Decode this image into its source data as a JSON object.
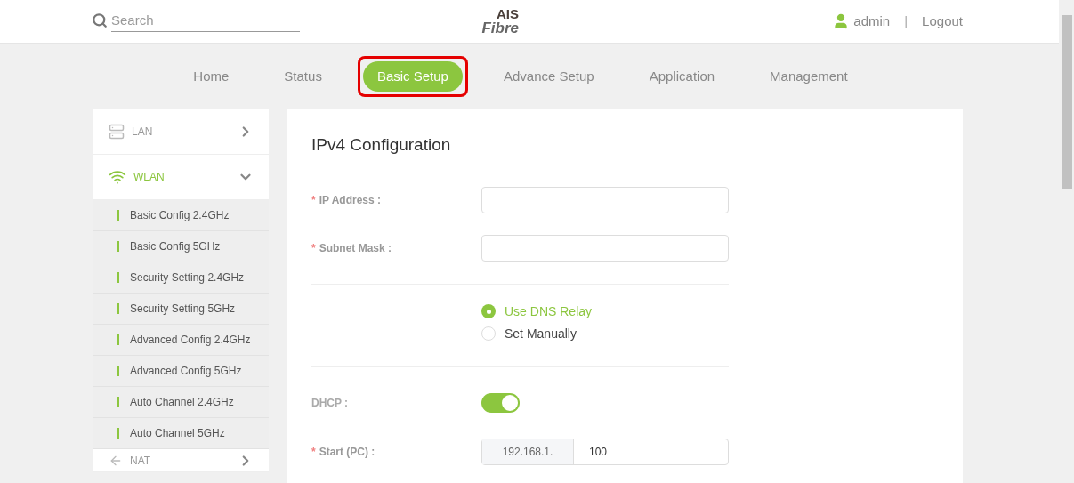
{
  "header": {
    "search": {
      "placeholder": "Search"
    },
    "logo": {
      "top": "AIS",
      "bottom": "Fibre"
    },
    "user": "admin",
    "separator": "|",
    "logout": "Logout"
  },
  "nav": [
    {
      "label": "Home",
      "selected": false,
      "highlighted": false
    },
    {
      "label": "Status",
      "selected": false,
      "highlighted": false
    },
    {
      "label": "Basic Setup",
      "selected": true,
      "highlighted": true
    },
    {
      "label": "Advance Setup",
      "selected": false,
      "highlighted": false
    },
    {
      "label": "Application",
      "selected": false,
      "highlighted": false
    },
    {
      "label": "Management",
      "selected": false,
      "highlighted": false
    }
  ],
  "sidebar": [
    {
      "label": "LAN",
      "kind": "lan",
      "expanded": false
    },
    {
      "label": "WLAN",
      "kind": "wifi",
      "expanded": true,
      "children": [
        {
          "label": "Basic Config 2.4GHz"
        },
        {
          "label": "Basic Config 5GHz"
        },
        {
          "label": "Security Setting 2.4GHz"
        },
        {
          "label": "Security Setting 5GHz"
        },
        {
          "label": "Advanced Config 2.4GHz"
        },
        {
          "label": "Advanced Config 5GHz"
        },
        {
          "label": "Auto Channel 2.4GHz"
        },
        {
          "label": "Auto Channel 5GHz"
        }
      ]
    },
    {
      "label": "NAT",
      "kind": "nat",
      "expanded": false
    }
  ],
  "form": {
    "title": "IPv4 Configuration",
    "fields": [
      {
        "label": "IP Address :",
        "marker": "*"
      },
      {
        "label": "Subnet Mask :",
        "marker": "*"
      }
    ],
    "dns": [
      {
        "label": "Use DNS Relay",
        "selected": true
      },
      {
        "label": "Set Manually",
        "selected": false
      }
    ],
    "dhcp": {
      "label": "DHCP :",
      "on": true
    },
    "start": {
      "label": "Start (PC) :",
      "marker": "*",
      "prefix": "192.168.1.",
      "value": "100"
    }
  }
}
